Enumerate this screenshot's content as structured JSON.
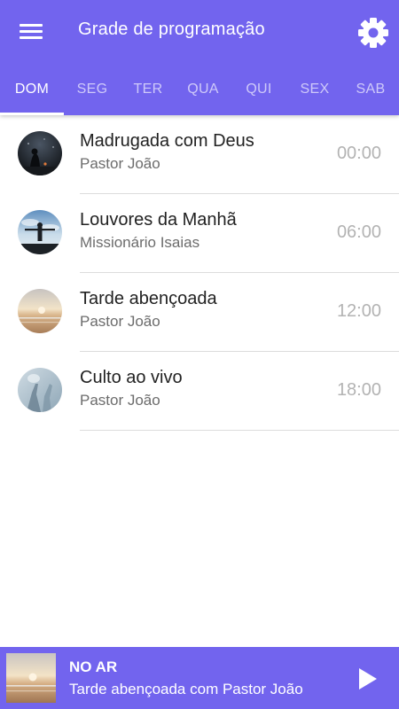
{
  "header": {
    "title": "Grade de programação",
    "menu_icon": "hamburger-menu-icon",
    "settings_icon": "gear-icon",
    "background": "#7264ee"
  },
  "tabs": [
    {
      "label": "DOM",
      "active": true
    },
    {
      "label": "SEG",
      "active": false
    },
    {
      "label": "TER",
      "active": false
    },
    {
      "label": "QUA",
      "active": false
    },
    {
      "label": "QUI",
      "active": false
    },
    {
      "label": "SEX",
      "active": false
    },
    {
      "label": "SAB",
      "active": false
    }
  ],
  "schedule": [
    {
      "title": "Madrugada com Deus",
      "host": "Pastor João",
      "time": "00:00"
    },
    {
      "title": "Louvores da Manhã",
      "host": "Missionário Isaias",
      "time": "06:00"
    },
    {
      "title": "Tarde abençoada",
      "host": "Pastor João",
      "time": "12:00"
    },
    {
      "title": "Culto ao vivo",
      "host": "Pastor João",
      "time": "18:00"
    }
  ],
  "player": {
    "label": "NO AR",
    "now_playing": "Tarde abençoada com Pastor João",
    "play_icon": "play-icon"
  }
}
